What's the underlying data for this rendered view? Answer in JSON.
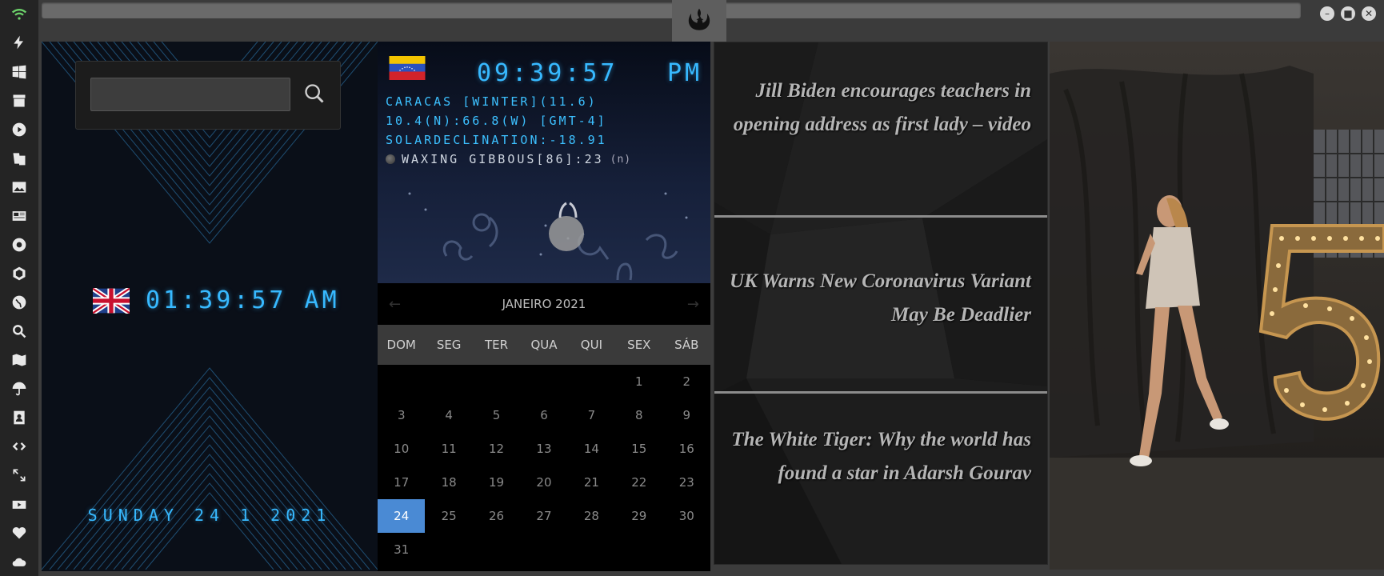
{
  "sidebar": {
    "icons": [
      "wifi-icon",
      "lightning-icon",
      "windows-icon",
      "archive-icon",
      "play-icon",
      "translate-icon",
      "image-icon",
      "news-icon",
      "aperture-icon",
      "hexagon-icon",
      "globe-icon",
      "search-icon",
      "map-icon",
      "umbrella-icon",
      "contacts-icon",
      "code-icon",
      "expand-icon",
      "youtube-icon",
      "heart-icon",
      "cloud-icon"
    ],
    "accent": "#6cd26a"
  },
  "window": {
    "min": "–",
    "max": "■",
    "close": "✕"
  },
  "clock_panel": {
    "search_placeholder": "",
    "uk_time": "01:39:57 AM",
    "date": "SUNDAY 24 1 2021",
    "accent": "#37b9ff"
  },
  "world_clock": {
    "time": "09:39:57",
    "ampm": "PM",
    "city_line": "CARACAS [WINTER](11.6)",
    "coords_line": "10.4(N):66.8(W) [GMT-4]",
    "declination_line": "SOLARDECLINATION:-18.91",
    "moon_line": "WAXING GIBBOUS[86]:23",
    "moon_suffix": "(n)"
  },
  "calendar": {
    "title": "JANEIRO 2021",
    "prev": "←",
    "next": "→",
    "weekdays": [
      "DOM",
      "SEG",
      "TER",
      "QUA",
      "QUI",
      "SEX",
      "SÁB"
    ],
    "weeks": [
      [
        "",
        "",
        "",
        "",
        "",
        "1",
        "2"
      ],
      [
        "3",
        "4",
        "5",
        "6",
        "7",
        "8",
        "9"
      ],
      [
        "10",
        "11",
        "12",
        "13",
        "14",
        "15",
        "16"
      ],
      [
        "17",
        "18",
        "19",
        "20",
        "21",
        "22",
        "23"
      ],
      [
        "24",
        "25",
        "26",
        "27",
        "28",
        "29",
        "30"
      ],
      [
        "31",
        "",
        "",
        "",
        "",
        "",
        ""
      ]
    ],
    "today": "24",
    "today_color": "#4a8ad4"
  },
  "news": {
    "items": [
      "Jill Biden encourages teachers in opening address as first lady – video",
      "UK Warns New Coronavirus Variant May Be Deadlier",
      "The White Tiger: Why the world has found a star in Adarsh Gourav"
    ]
  },
  "photo": {
    "sign_text": "5"
  }
}
